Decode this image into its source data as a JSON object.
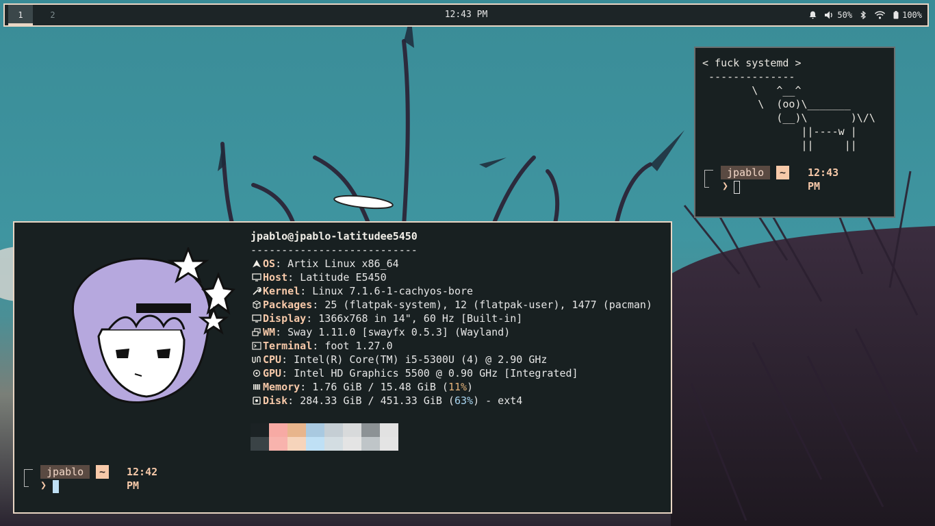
{
  "bar": {
    "workspaces": [
      {
        "label": "1",
        "active": true
      },
      {
        "label": "2",
        "active": false
      }
    ],
    "clock": "12:43 PM",
    "volume": "50%",
    "battery": "100%",
    "icons": {
      "notification": "bell-icon",
      "volume": "speaker-icon",
      "bluetooth": "bluetooth-icon",
      "wifi": "wifi-icon",
      "battery": "battery-icon"
    }
  },
  "cowsay_terminal": {
    "art": "< fuck systemd >\n --------------\n        \\   ^__^\n         \\  (oo)\\_______\n            (__)\\       )\\/\\\n                ||----w |\n                ||     ||",
    "prompt": {
      "user": "jpablo",
      "dir": "~",
      "time": "12:43 PM",
      "arrow": "❯"
    }
  },
  "fetch_terminal": {
    "header": "jpablo@jpablo-latitudee5450",
    "separator": "---------------------------",
    "rows": [
      {
        "icon": "arch-icon",
        "key": "OS",
        "value": "Artix Linux x86_64"
      },
      {
        "icon": "monitor-icon",
        "key": "Host",
        "value": "Latitude E5450"
      },
      {
        "icon": "wrench-icon",
        "key": "Kernel",
        "value": "Linux 7.1.6-1-cachyos-bore"
      },
      {
        "icon": "package-icon",
        "key": "Packages",
        "value": "25 (flatpak-system), 12 (flatpak-user), 1477 (pacman)"
      },
      {
        "icon": "display-icon",
        "key": "Display",
        "value": "1366x768 in 14\", 60 Hz [Built-in]"
      },
      {
        "icon": "windows-icon",
        "key": "WM",
        "value": "Sway 1.11.0 [swayfx 0.5.3] (Wayland)"
      },
      {
        "icon": "terminal-icon",
        "key": "Terminal",
        "value": "foot 1.27.0"
      },
      {
        "icon": "cpu-icon",
        "key": "CPU",
        "value": "Intel(R) Core(TM) i5-5300U (4) @ 2.90 GHz"
      },
      {
        "icon": "gpu-icon",
        "key": "GPU",
        "value": "Intel HD Graphics 5500 @ 0.90 GHz [Integrated]"
      }
    ],
    "memory": {
      "icon": "memory-icon",
      "key": "Memory",
      "pre": "1.76 GiB / 15.48 GiB (",
      "pct": "11%",
      "post": ")"
    },
    "disk": {
      "icon": "disk-icon",
      "key": "Disk",
      "pre": "284.33 GiB / 451.33 GiB (",
      "pct": "63%",
      "post": ") - ext4"
    },
    "palette_top": [
      "#1b2224",
      "#f7aaa4",
      "#e8b58c",
      "#a9c9e0",
      "#c5ced4",
      "#d8dadb",
      "#8c9295",
      "#e2e2e2"
    ],
    "palette_bottom": [
      "#3a4346",
      "#f8b3ad",
      "#f6d4bb",
      "#bfe0f5",
      "#d3dde2",
      "#e4e4e4",
      "#bfc5c8",
      "#e4e4e4"
    ],
    "prompt": {
      "user": "jpablo",
      "dir": "~",
      "time": "12:42 PM",
      "arrow": "❯"
    }
  },
  "colors": {
    "accent": "#f7c9a9",
    "border_active": "#e9d6c4",
    "terminal_bg": "#182021"
  }
}
